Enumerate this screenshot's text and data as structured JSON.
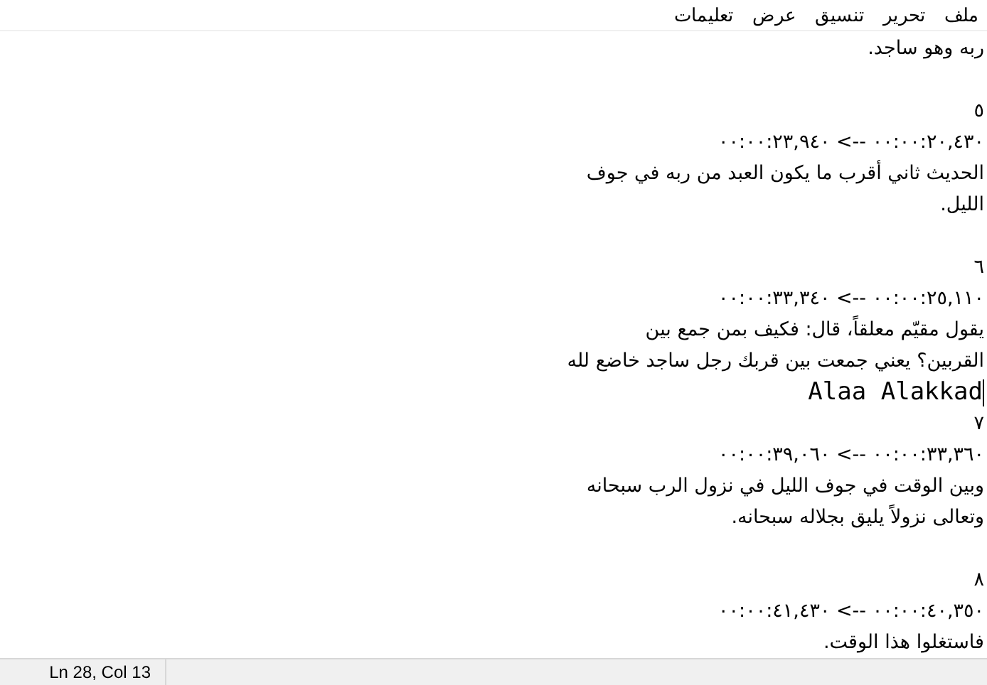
{
  "menu": [
    {
      "label": "ملف"
    },
    {
      "label": "تحرير"
    },
    {
      "label": "تنسيق"
    },
    {
      "label": "عرض"
    },
    {
      "label": "تعليمات"
    }
  ],
  "lines": [
    {
      "kind": "arabic",
      "text": "ربه وهو ساجد.",
      "caret": false
    },
    {
      "kind": "blank",
      "caret": false
    },
    {
      "kind": "arabic",
      "text": "٥",
      "caret": false
    },
    {
      "kind": "arabic",
      "text": "٠٠:٠٠:٢٠,٤٣٠ --> ٠٠:٠٠:٢٣,٩٤٠",
      "caret": false
    },
    {
      "kind": "arabic",
      "text": "الحديث ثاني أقرب ما يكون العبد من ربه في جوف",
      "caret": false
    },
    {
      "kind": "arabic",
      "text": "الليل.",
      "caret": false
    },
    {
      "kind": "blank",
      "caret": false
    },
    {
      "kind": "arabic",
      "text": "٦",
      "caret": false
    },
    {
      "kind": "arabic",
      "text": "٠٠:٠٠:٢٥,١١٠ --> ٠٠:٠٠:٣٣,٣٤٠",
      "caret": false
    },
    {
      "kind": "arabic",
      "text": "يقول مقيّم معلقاً، قال: فكيف بمن جمع بين",
      "caret": false
    },
    {
      "kind": "arabic",
      "text": "القربين؟ يعني جمعت بين قربك رجل ساجد خاضع لله",
      "caret": false
    },
    {
      "kind": "latin",
      "text": "Alaa Alakkad",
      "caret": true
    },
    {
      "kind": "arabic",
      "text": "٧",
      "caret": false
    },
    {
      "kind": "arabic",
      "text": "٠٠:٠٠:٣٣,٣٦٠ --> ٠٠:٠٠:٣٩,٠٦٠",
      "caret": false
    },
    {
      "kind": "arabic",
      "text": "وبين الوقت في جوف الليل في نزول الرب سبحانه",
      "caret": false
    },
    {
      "kind": "arabic",
      "text": "وتعالى نزولاً يليق بجلاله سبحانه.",
      "caret": false
    },
    {
      "kind": "blank",
      "caret": false
    },
    {
      "kind": "arabic",
      "text": "٨",
      "caret": false
    },
    {
      "kind": "arabic",
      "text": "٠٠:٠٠:٤٠,٣٥٠ --> ٠٠:٠٠:٤١,٤٣٠",
      "caret": false
    },
    {
      "kind": "arabic",
      "text": "فاستغلوا هذا الوقت.",
      "caret": false
    }
  ],
  "status_bar": {
    "position": "Ln 28, Col 13"
  }
}
